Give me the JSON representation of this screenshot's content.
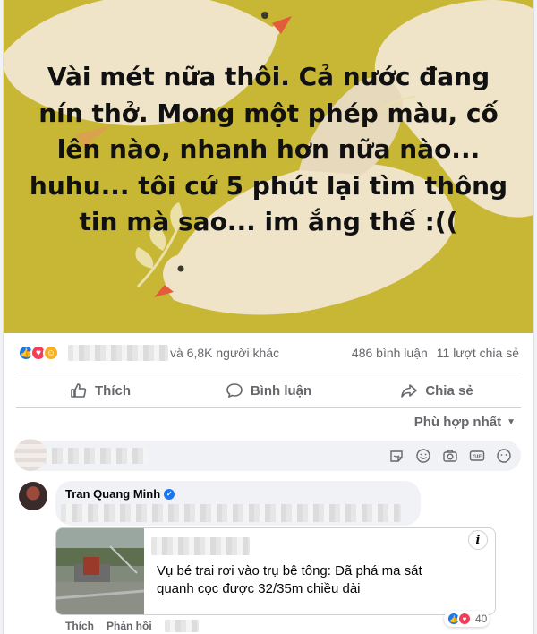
{
  "post": {
    "text": "Vài mét nữa thôi. Cả nước đang nín thở. Mong một phép màu, cố lên nào, nhanh hơn nữa nào... huhu... tôi cứ 5 phút lại tìm thông tin mà sao... im ắng thế :((",
    "background_color": "#c8b735"
  },
  "stats": {
    "reactions": [
      "like",
      "love",
      "care"
    ],
    "others": "và 6,8K người khác",
    "comments": "486 bình luận",
    "shares": "11 lượt chia sẻ"
  },
  "actions": {
    "like": "Thích",
    "comment": "Bình luận",
    "share": "Chia sẻ"
  },
  "filter": {
    "label": "Phù hợp nhất"
  },
  "comment_input": {
    "icons": [
      "sticker-icon",
      "emoji-icon",
      "camera-icon",
      "gif-icon",
      "sticker-face-icon"
    ]
  },
  "comment": {
    "author": "Tran Quang Minh",
    "preview_title": "Vụ bé trai rơi vào trụ bê tông: Đã phá ma sát quanh cọc được 32/35m chiều dài",
    "like_label": "Thích",
    "reply_label": "Phản hồi",
    "reaction_count": "40"
  },
  "colors": {
    "accent": "#1877f2",
    "love": "#f33e58",
    "muted_text": "#65676b"
  }
}
